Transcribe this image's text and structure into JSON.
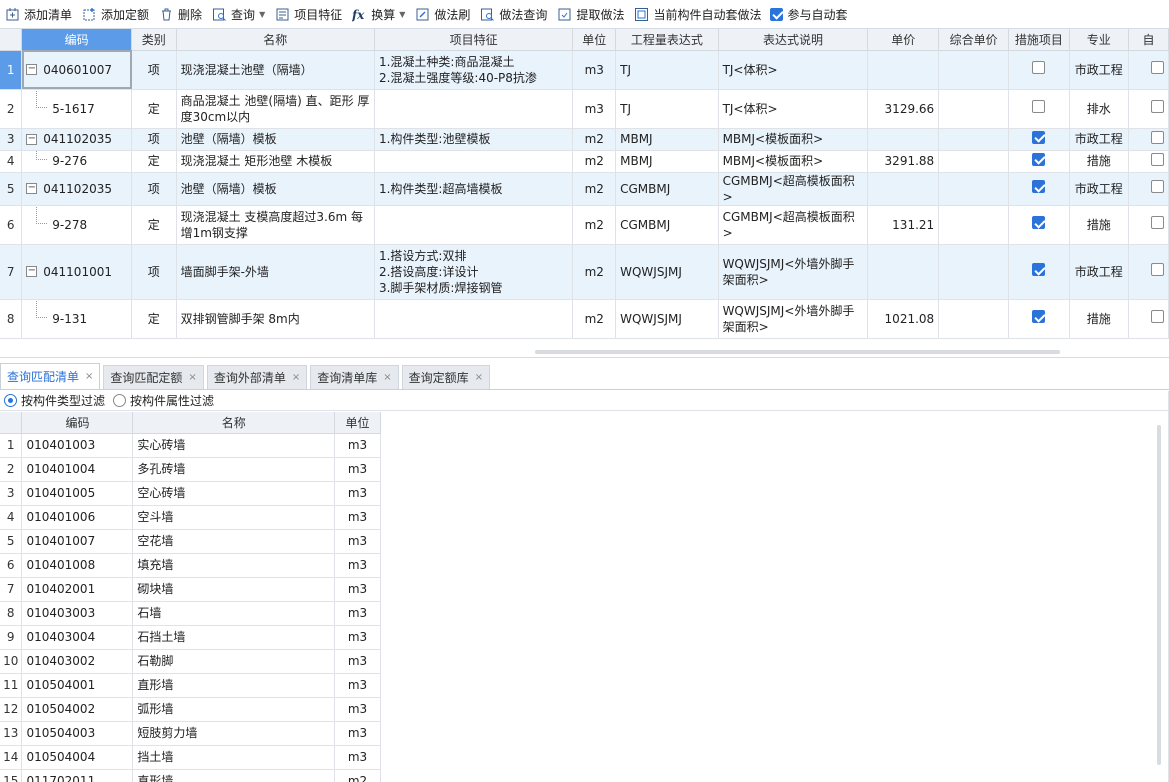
{
  "toolbar": {
    "add_list": "添加清单",
    "add_quota": "添加定额",
    "delete": "删除",
    "query": "查询",
    "item_feature": "项目特征",
    "convert": "换算",
    "method_brush": "做法刷",
    "method_query": "做法查询",
    "extract_method": "提取做法",
    "auto_method": "当前构件自动套做法",
    "join_auto": "参与自动套",
    "join_auto_checked": true
  },
  "grid": {
    "headers": [
      "编码",
      "类别",
      "名称",
      "项目特征",
      "单位",
      "工程量表达式",
      "表达式说明",
      "单价",
      "综合单价",
      "措施项目",
      "专业",
      "自"
    ],
    "rows": [
      {
        "n": "1",
        "code": "040601007",
        "type": "项",
        "name": "现浇混凝土池壁（隔墙）",
        "feature": [
          "1.混凝土种类:商品混凝土",
          "2.混凝土强度等级:40-P8抗渗"
        ],
        "unit": "m3",
        "expr": "TJ",
        "desc": [
          "TJ<体积>"
        ],
        "price": "",
        "total": "",
        "measure": false,
        "major": "市政工程",
        "level": 0
      },
      {
        "n": "2",
        "code": "5-1617",
        "type": "定",
        "name": "商品混凝土 池壁(隔墙) 直、距形 厚度30cm以内",
        "feature": [],
        "unit": "m3",
        "expr": "TJ",
        "desc": [
          "TJ<体积>"
        ],
        "price": "3129.66",
        "total": "",
        "measure": false,
        "major": "排水",
        "level": 1
      },
      {
        "n": "3",
        "code": "041102035",
        "type": "项",
        "name": "池壁（隔墙）模板",
        "feature": [
          "1.构件类型:池壁模板"
        ],
        "unit": "m2",
        "expr": "MBMJ",
        "desc": [
          "MBMJ<模板面积>"
        ],
        "price": "",
        "total": "",
        "measure": true,
        "major": "市政工程",
        "level": 0
      },
      {
        "n": "4",
        "code": "9-276",
        "type": "定",
        "name": "现浇混凝土 矩形池壁 木模板",
        "feature": [],
        "unit": "m2",
        "expr": "MBMJ",
        "desc": [
          "MBMJ<模板面积>"
        ],
        "price": "3291.88",
        "total": "",
        "measure": true,
        "major": "措施",
        "level": 1
      },
      {
        "n": "5",
        "code": "041102035",
        "type": "项",
        "name": "池壁（隔墙）模板",
        "feature": [
          "1.构件类型:超高墙模板"
        ],
        "unit": "m2",
        "expr": "CGMBMJ",
        "desc": [
          "CGMBMJ<超高模板面积>"
        ],
        "price": "",
        "total": "",
        "measure": true,
        "major": "市政工程",
        "level": 0
      },
      {
        "n": "6",
        "code": "9-278",
        "type": "定",
        "name": "现浇混凝土 支模高度超过3.6m 每增1m钢支撑",
        "feature": [],
        "unit": "m2",
        "expr": "CGMBMJ",
        "desc": [
          "CGMBMJ<超高模板面积>"
        ],
        "price": "131.21",
        "total": "",
        "measure": true,
        "major": "措施",
        "level": 1
      },
      {
        "n": "7",
        "code": "041101001",
        "type": "项",
        "name": "墙面脚手架-外墙",
        "feature": [
          "1.搭设方式:双排",
          "2.搭设高度:详设计",
          "3.脚手架材质:焊接钢管"
        ],
        "unit": "m2",
        "expr": "WQWJSJMJ",
        "desc": [
          "WQWJSJMJ<外墙外脚手",
          "架面积>"
        ],
        "price": "",
        "total": "",
        "measure": true,
        "major": "市政工程",
        "level": 0
      },
      {
        "n": "8",
        "code": "9-131",
        "type": "定",
        "name": "双排钢管脚手架 8m内",
        "feature": [],
        "unit": "m2",
        "expr": "WQWJSJMJ",
        "desc": [
          "WQWJSJMJ<外墙外脚手",
          "架面积>"
        ],
        "price": "1021.08",
        "total": "",
        "measure": true,
        "major": "措施",
        "level": 1
      }
    ]
  },
  "tabs": [
    {
      "label": "查询匹配清单",
      "active": true
    },
    {
      "label": "查询匹配定额",
      "active": false
    },
    {
      "label": "查询外部清单",
      "active": false
    },
    {
      "label": "查询清单库",
      "active": false
    },
    {
      "label": "查询定额库",
      "active": false
    }
  ],
  "filter": {
    "by_type": "按构件类型过滤",
    "by_attr": "按构件属性过滤",
    "selected": "by_type"
  },
  "lower": {
    "headers": [
      "编码",
      "名称",
      "单位"
    ],
    "rows": [
      [
        "1",
        "010401003",
        "实心砖墙",
        "m3"
      ],
      [
        "2",
        "010401004",
        "多孔砖墙",
        "m3"
      ],
      [
        "3",
        "010401005",
        "空心砖墙",
        "m3"
      ],
      [
        "4",
        "010401006",
        "空斗墙",
        "m3"
      ],
      [
        "5",
        "010401007",
        "空花墙",
        "m3"
      ],
      [
        "6",
        "010401008",
        "填充墙",
        "m3"
      ],
      [
        "7",
        "010402001",
        "砌块墙",
        "m3"
      ],
      [
        "8",
        "010403003",
        "石墙",
        "m3"
      ],
      [
        "9",
        "010403004",
        "石挡土墙",
        "m3"
      ],
      [
        "10",
        "010403002",
        "石勒脚",
        "m3"
      ],
      [
        "11",
        "010504001",
        "直形墙",
        "m3"
      ],
      [
        "12",
        "010504002",
        "弧形墙",
        "m3"
      ],
      [
        "13",
        "010504003",
        "短肢剪力墙",
        "m3"
      ],
      [
        "14",
        "010504004",
        "挡土墙",
        "m3"
      ],
      [
        "15",
        "011702011",
        "直形墙",
        "m2"
      ]
    ]
  },
  "colors": {
    "accent": "#2a73d8",
    "header_selected": "#5b9be8",
    "row_highlight": "#e9f3fc"
  }
}
